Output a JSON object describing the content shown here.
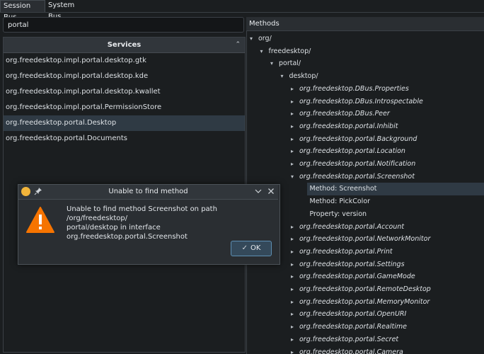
{
  "tabs": [
    {
      "label": "Session Bus",
      "active": true
    },
    {
      "label": "System Bus",
      "active": false
    }
  ],
  "search": {
    "value": "portal"
  },
  "services": {
    "header": "Services",
    "sort_icon": "chevron-up-icon",
    "items": [
      {
        "label": "org.freedesktop.impl.portal.desktop.gtk",
        "selected": false
      },
      {
        "label": "org.freedesktop.impl.portal.desktop.kde",
        "selected": false
      },
      {
        "label": "org.freedesktop.impl.portal.desktop.kwallet",
        "selected": false
      },
      {
        "label": "org.freedesktop.impl.portal.PermissionStore",
        "selected": false
      },
      {
        "label": "org.freedesktop.portal.Desktop",
        "selected": true
      },
      {
        "label": "org.freedesktop.portal.Documents",
        "selected": false
      }
    ]
  },
  "methods": {
    "header": "Methods",
    "tree": [
      {
        "label": "org/",
        "depth": 0,
        "state": "expanded",
        "italic": false
      },
      {
        "label": "freedesktop/",
        "depth": 1,
        "state": "expanded",
        "italic": false
      },
      {
        "label": "portal/",
        "depth": 2,
        "state": "expanded",
        "italic": false
      },
      {
        "label": "desktop/",
        "depth": 3,
        "state": "expanded",
        "italic": false
      },
      {
        "label": "org.freedesktop.DBus.Properties",
        "depth": 4,
        "state": "collapsed",
        "italic": true
      },
      {
        "label": "org.freedesktop.DBus.Introspectable",
        "depth": 4,
        "state": "collapsed",
        "italic": true
      },
      {
        "label": "org.freedesktop.DBus.Peer",
        "depth": 4,
        "state": "collapsed",
        "italic": true
      },
      {
        "label": "org.freedesktop.portal.Inhibit",
        "depth": 4,
        "state": "collapsed",
        "italic": true
      },
      {
        "label": "org.freedesktop.portal.Background",
        "depth": 4,
        "state": "collapsed",
        "italic": true
      },
      {
        "label": "org.freedesktop.portal.Location",
        "depth": 4,
        "state": "collapsed",
        "italic": true
      },
      {
        "label": "org.freedesktop.portal.Notification",
        "depth": 4,
        "state": "collapsed",
        "italic": true
      },
      {
        "label": "org.freedesktop.portal.Screenshot",
        "depth": 4,
        "state": "expanded",
        "italic": true
      },
      {
        "label": "Method: Screenshot",
        "depth": 5,
        "state": "leaf",
        "italic": false,
        "selected": true
      },
      {
        "label": "Method: PickColor",
        "depth": 5,
        "state": "leaf",
        "italic": false
      },
      {
        "label": "Property: version",
        "depth": 5,
        "state": "leaf",
        "italic": false
      },
      {
        "label": "org.freedesktop.portal.Account",
        "depth": 4,
        "state": "collapsed",
        "italic": true
      },
      {
        "label": "org.freedesktop.portal.NetworkMonitor",
        "depth": 4,
        "state": "collapsed",
        "italic": true
      },
      {
        "label": "org.freedesktop.portal.Print",
        "depth": 4,
        "state": "collapsed",
        "italic": true
      },
      {
        "label": "org.freedesktop.portal.Settings",
        "depth": 4,
        "state": "collapsed",
        "italic": true
      },
      {
        "label": "org.freedesktop.portal.GameMode",
        "depth": 4,
        "state": "collapsed",
        "italic": true
      },
      {
        "label": "org.freedesktop.portal.RemoteDesktop",
        "depth": 4,
        "state": "collapsed",
        "italic": true
      },
      {
        "label": "org.freedesktop.portal.MemoryMonitor",
        "depth": 4,
        "state": "collapsed",
        "italic": true
      },
      {
        "label": "org.freedesktop.portal.OpenURI",
        "depth": 4,
        "state": "collapsed",
        "italic": true
      },
      {
        "label": "org.freedesktop.portal.Realtime",
        "depth": 4,
        "state": "collapsed",
        "italic": true
      },
      {
        "label": "org.freedesktop.portal.Secret",
        "depth": 4,
        "state": "collapsed",
        "italic": true
      },
      {
        "label": "org.freedesktop.portal.Camera",
        "depth": 4,
        "state": "collapsed",
        "italic": true
      }
    ]
  },
  "dialog": {
    "title": "Unable to find method",
    "message_line1": "Unable to find method Screenshot on path /org/freedesktop/",
    "message_line2": "portal/desktop in interface org.freedesktop.portal.Screenshot",
    "ok_label": "OK",
    "icon": "warning-icon"
  },
  "colors": {
    "background": "#1b1e20",
    "selection": "#2f3a44",
    "accent": "#5d8fb3",
    "warning": "#f67400"
  }
}
